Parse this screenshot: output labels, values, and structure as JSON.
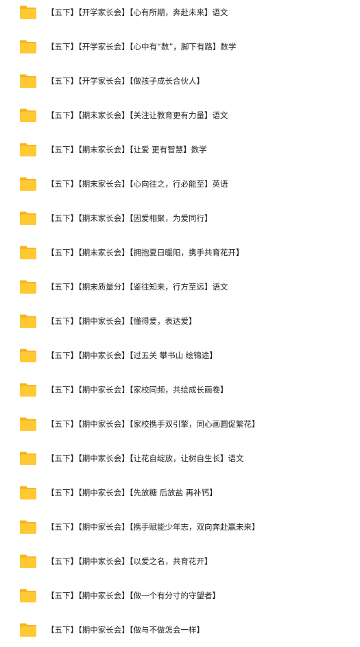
{
  "icons": {
    "item": "folder-icon"
  },
  "colors": {
    "folder_body": "#FFC933",
    "folder_tab": "#F5B41E",
    "text": "#222222",
    "background": "#FFFFFF"
  },
  "files": [
    {
      "name": "【五下】【开学家长会】【心有所期，奔赴未来】语文"
    },
    {
      "name": "【五下】【开学家长会】【心中有“数”，脚下有路】数学"
    },
    {
      "name": "【五下】【开学家长会】【做孩子成长合伙人】"
    },
    {
      "name": "【五下】【期末家长会】【关注让教育更有力量】语文"
    },
    {
      "name": "【五下】【期末家长会】【让爱 更有智慧】数学"
    },
    {
      "name": "【五下】【期末家长会】【心向往之，行必能至】英语"
    },
    {
      "name": "【五下】【期末家长会】【因爱相聚，为爱同行】"
    },
    {
      "name": "【五下】【期末家长会】【拥抱夏日暖阳，携手共育花开】"
    },
    {
      "name": "【五下】【期末质量分】【鉴往知来，行方至远】语文"
    },
    {
      "name": "【五下】【期中家长会】【懂得爱，表达爱】"
    },
    {
      "name": "【五下】【期中家长会】【过五关 攀书山 绘锦途】"
    },
    {
      "name": "【五下】【期中家长会】【家校同频，共绘成长画卷】"
    },
    {
      "name": "【五下】【期中家长会】【家校携手双引擎，同心画圆促繁花】"
    },
    {
      "name": "【五下】【期中家长会】【让花自绽放，让树自生长】语文"
    },
    {
      "name": "【五下】【期中家长会】【先放糖 后放盐 再补钙】"
    },
    {
      "name": "【五下】【期中家长会】【携手赋能少年志，双向奔赴赢未来】"
    },
    {
      "name": "【五下】【期中家长会】【以爱之名，共育花开】"
    },
    {
      "name": "【五下】【期中家长会】【做一个有分寸的守望者】"
    },
    {
      "name": "【五下】【期中家长会】【做与不做怎会一样】"
    }
  ]
}
